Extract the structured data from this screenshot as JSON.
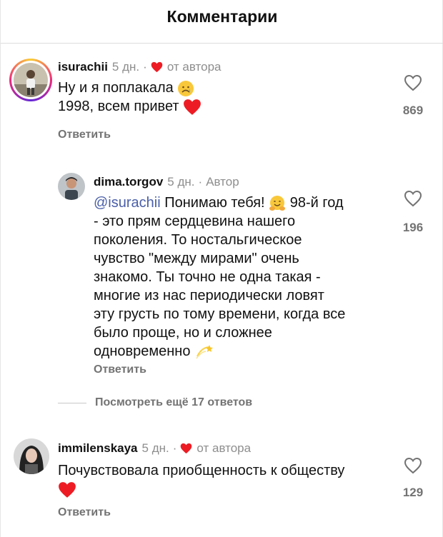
{
  "header": {
    "title": "Комментарии"
  },
  "comments": [
    {
      "username": "isurachii",
      "time": "5 дн.",
      "separator": "·",
      "author_like": "от автора",
      "line1": "Ну и я поплакала",
      "line2": "1998, всем привет",
      "line1_emoji": "crying-face",
      "line2_emoji": "red-heart",
      "likes": "869",
      "reply_label": "Ответить"
    },
    {
      "username": "dima.torgov",
      "time": "5 дн.",
      "separator": "·",
      "badge": "Автор",
      "mention": "@isurachii",
      "lines": [
        " Понимаю тебя! ",
        "- это прям сердцевина нашего",
        "поколения. То ностальгическое",
        "чувство \"между мирами\" очень",
        "знакомо. Ты точно не одна такая -",
        "многие из нас периодически ловят",
        "эту грусть по тому времени, когда все",
        "было проще, но и сложнее",
        "одновременно"
      ],
      "line1_tail": "98-й год",
      "likes": "196",
      "reply_label": "Ответить"
    },
    {
      "username": "immilenskaya",
      "time": "5 дн.",
      "separator": "·",
      "author_like": "от автора",
      "line1": "Почувствовала приобщенность к обществу",
      "likes": "129",
      "reply_label": "Ответить"
    }
  ],
  "more_replies": "Посмотреть ещё 17 ответов",
  "colors": {
    "heart": "#ed1c24",
    "muted": "#737373",
    "mention": "#4a5fa8"
  }
}
